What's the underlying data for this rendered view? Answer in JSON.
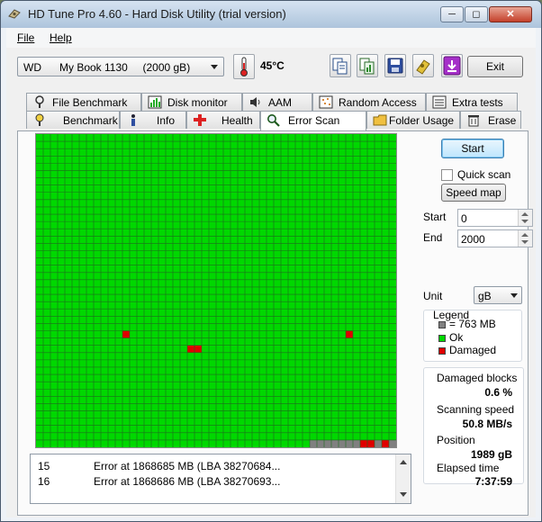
{
  "window": {
    "title": "HD Tune Pro 4.60 - Hard Disk Utility (trial version)"
  },
  "menu": {
    "file": "File",
    "help": "Help"
  },
  "toolbar": {
    "drive": "WD      My Book 1130     (2000 gB)",
    "temperature": "45°C",
    "exit_label": "Exit",
    "icons": [
      "copy-info-icon",
      "copy-screen-icon",
      "save-icon",
      "options-icon",
      "download-icon"
    ]
  },
  "tabs": {
    "top": [
      "File Benchmark",
      "Disk monitor",
      "AAM",
      "Random Access",
      "Extra tests"
    ],
    "bottom": [
      "Benchmark",
      "Info",
      "Health",
      "Error Scan",
      "Folder Usage",
      "Erase"
    ],
    "active": "Error Scan"
  },
  "scan": {
    "start_button": "Start",
    "quick_scan_label": "Quick scan",
    "quick_scan_checked": false,
    "speed_map_button": "Speed map",
    "start_label": "Start",
    "start_value": "0",
    "end_label": "End",
    "end_value": "2000",
    "unit_label": "Unit",
    "unit_value": "gB"
  },
  "legend": {
    "title": "Legend",
    "block_size": "= 763 MB",
    "ok": "Ok",
    "damaged": "Damaged"
  },
  "stats": {
    "damaged_blocks_label": "Damaged blocks",
    "damaged_blocks_value": "0.6 %",
    "scanning_speed_label": "Scanning speed",
    "scanning_speed_value": "50.8 MB/s",
    "position_label": "Position",
    "position_value": "1989 gB",
    "elapsed_time_label": "Elapsed time",
    "elapsed_time_value": "7:37:59"
  },
  "log": [
    {
      "num": "15",
      "text": "Error at 1868685 MB (LBA 38270684..."
    },
    {
      "num": "16",
      "text": "Error at 1868686 MB (LBA 38270693..."
    }
  ],
  "colors": {
    "ok": "#00d800",
    "damaged": "#e00000",
    "unscanned": "#808080",
    "grid_line": "#1e6b1e"
  },
  "grid": {
    "cols": 50,
    "rows": 43,
    "damaged_blocks": [
      [
        12,
        27
      ],
      [
        21,
        29
      ],
      [
        22,
        29
      ],
      [
        43,
        27
      ],
      [
        45,
        42
      ],
      [
        46,
        42
      ],
      [
        48,
        42
      ]
    ],
    "unscanned_from": {
      "row": 42,
      "col": 38
    }
  }
}
